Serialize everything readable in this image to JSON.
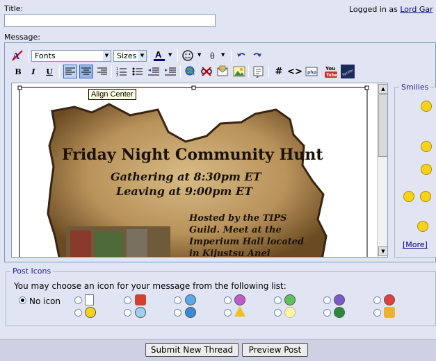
{
  "title_label": "Title:",
  "title_value": "",
  "logged_in_prefix": "Logged in as",
  "logged_in_user": "Lord Gar",
  "message_label": "Message:",
  "toolbar": {
    "fonts": "Fonts",
    "sizes": "Sizes",
    "tooltip": "Align Center"
  },
  "flyer": {
    "heading": "Friday Night Community Hunt",
    "line1": "Gathering at 8:30pm ET",
    "line2": "Leaving at 9:00pm ET",
    "hosted": [
      "Hosted by the TIPS",
      "Guild. Meet at the",
      "Imperium Hall located",
      "in Kijustsu Anei"
    ]
  },
  "smilies": {
    "legend": "Smilies",
    "more": "[More]"
  },
  "post_icons": {
    "legend": "Post Icons",
    "instruction": "You may choose an icon for your message from the following list:",
    "no_icon": "No icon"
  },
  "buttons": {
    "submit": "Submit New Thread",
    "preview": "Preview Post"
  },
  "colors": {
    "background": "#E1E4F2",
    "link": "#000080",
    "legend": "#22229C",
    "parchment": "#C7A56A"
  }
}
